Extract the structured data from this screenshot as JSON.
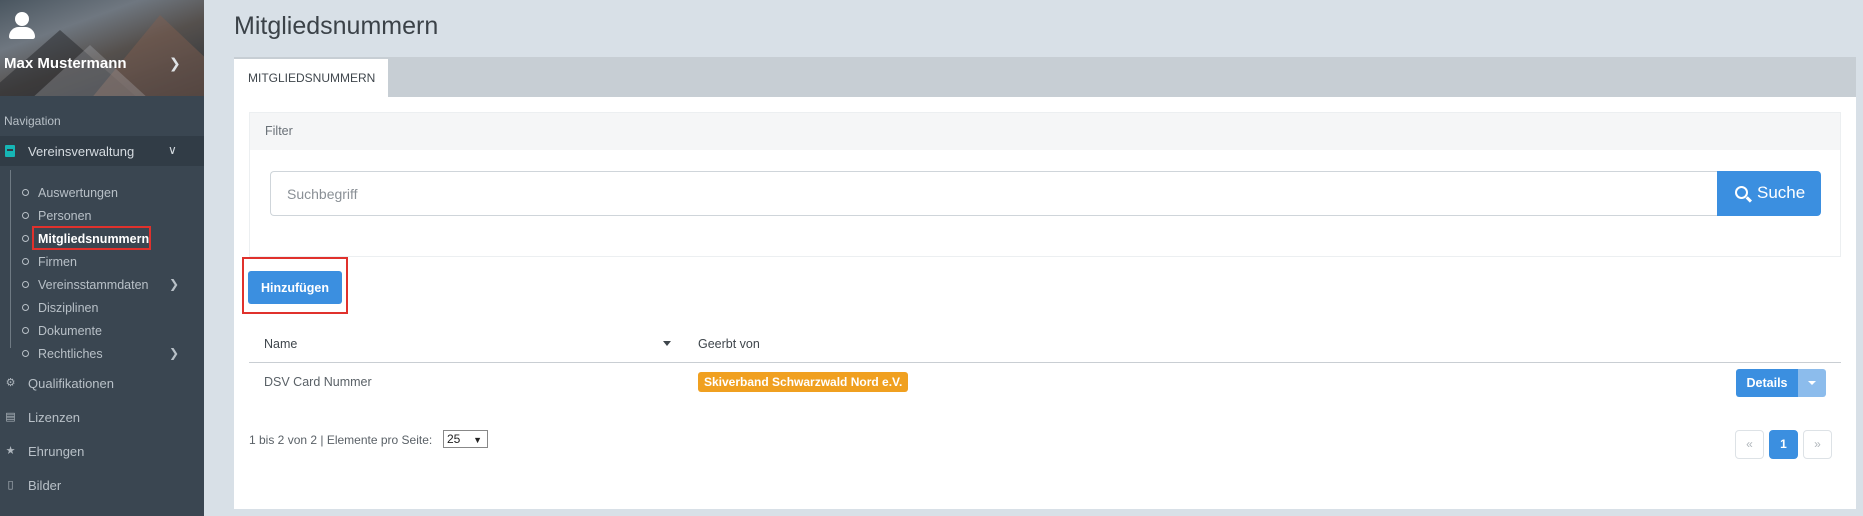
{
  "profile": {
    "name": "Max Mustermann"
  },
  "sidebar": {
    "heading": "Navigation",
    "section": {
      "label": "Vereinsverwaltung",
      "accent_color": "#16b6b6"
    },
    "sub_items": [
      {
        "label": "Auswertungen"
      },
      {
        "label": "Personen"
      },
      {
        "label": "Mitgliedsnummern",
        "active": true
      },
      {
        "label": "Firmen"
      },
      {
        "label": "Vereinsstammdaten",
        "has_children": true
      },
      {
        "label": "Disziplinen"
      },
      {
        "label": "Dokumente"
      },
      {
        "label": "Rechtliches",
        "has_children": true
      }
    ],
    "main_items": [
      {
        "label": "Qualifikationen",
        "icon": "gear-icon"
      },
      {
        "label": "Lizenzen",
        "icon": "id-card-icon"
      },
      {
        "label": "Ehrungen",
        "icon": "trophy-icon"
      },
      {
        "label": "Bilder",
        "icon": "file-icon"
      }
    ]
  },
  "page": {
    "title": "Mitgliedsnummern"
  },
  "tabs": [
    {
      "label": "MITGLIEDSNUMMERN",
      "active": true
    }
  ],
  "filter": {
    "title": "Filter",
    "search_placeholder": "Suchbegriff",
    "search_button": "Suche"
  },
  "actions": {
    "add_label": "Hinzufügen"
  },
  "table": {
    "columns": [
      "Name",
      "Geerbt von"
    ],
    "rows": [
      {
        "name": "DSV Card Nummer",
        "inherited_from": "Skiverband Schwarzwald Nord e.V.",
        "action": "Details"
      }
    ]
  },
  "pagination": {
    "info": "1 bis 2 von 2 | Elemente pro Seite:",
    "page_size": "25",
    "prev": "«",
    "current": "1",
    "next": "»"
  },
  "colors": {
    "primary": "#3b8fe0",
    "badge": "#f0a020",
    "highlight": "#e0312c",
    "sidebar_bg": "#3a4651"
  }
}
